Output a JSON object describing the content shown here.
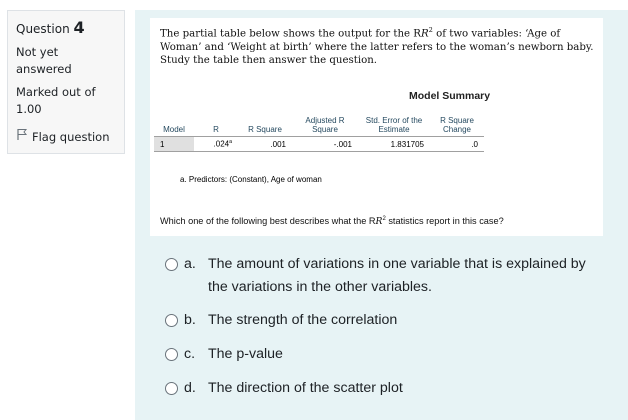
{
  "info": {
    "question_label": "Question",
    "question_number": "4",
    "status": "Not yet answered",
    "marked_out_of": "Marked out of",
    "marks": "1.00",
    "flag_label": "Flag question"
  },
  "panel": {
    "intro_part1": "The partial table below shows the output for the R",
    "intro_sup": "2",
    "intro_part2": " of two variables: ‘Age of Woman’ and ‘Weight at birth’ where the latter refers to the woman’s newborn baby. Study the table then answer the question.",
    "table_title": "Model Summary",
    "table": {
      "headers": [
        "Model",
        "R",
        "R Square",
        "Adjusted R Square",
        "Std. Error of the Estimate",
        "R Square Change"
      ],
      "row": {
        "model": "1",
        "r": ".024",
        "r_sup": "a",
        "r_square": ".001",
        "adj_r_square": "-.001",
        "std_error": "1.831705",
        "r_square_change": ".0"
      }
    },
    "footnote": "a. Predictors: (Constant), Age of woman",
    "question_part1": "Which one of the following best describes what the R",
    "question_sup": "2",
    "question_part2": " statistics report in this case?"
  },
  "options": [
    {
      "letter": "a.",
      "text": "The amount of variations in one variable that is explained by the variations in the other variables."
    },
    {
      "letter": "b.",
      "text": "The strength of the correlation"
    },
    {
      "letter": "c.",
      "text": "The p-value"
    },
    {
      "letter": "d.",
      "text": "The direction of the scatter plot"
    }
  ],
  "colors": {
    "panel_bg": "#e7f3f5",
    "info_bg": "#f7f7f7",
    "header_text": "#264a60"
  },
  "icons": {
    "flag": "flag-icon",
    "radio": "radio-icon"
  }
}
